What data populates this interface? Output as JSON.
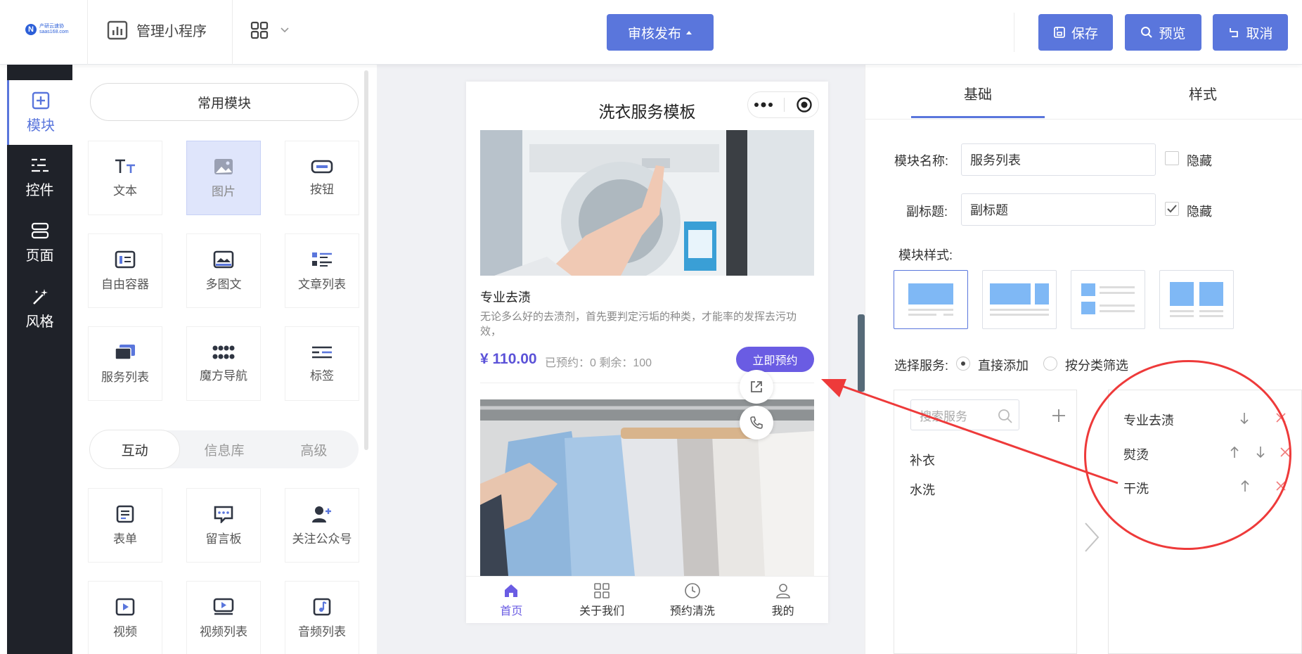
{
  "header": {
    "logo_text": "产研云速协",
    "logo_sub": "saas168.com",
    "manage_label": "管理小程序",
    "publish_label": "审核发布",
    "save_label": "保存",
    "preview_label": "预览",
    "cancel_label": "取消",
    "accent": "#5a76dc"
  },
  "leftnav": {
    "items": [
      {
        "label": "模块",
        "icon": "plus-square-icon"
      },
      {
        "label": "控件",
        "icon": "sliders-icon"
      },
      {
        "label": "页面",
        "icon": "pages-icon"
      },
      {
        "label": "风格",
        "icon": "magic-wand-icon"
      }
    ]
  },
  "modules": {
    "common_label": "常用模块",
    "tiles": [
      "文本",
      "图片",
      "按钮",
      "自由容器",
      "多图文",
      "文章列表",
      "服务列表",
      "魔方导航",
      "标签"
    ],
    "tabs": [
      "互动",
      "信息库",
      "高级"
    ],
    "interactive": [
      "表单",
      "留言板",
      "关注公众号",
      "视频",
      "视频列表",
      "音频列表"
    ]
  },
  "phone": {
    "title": "洗衣服务模板",
    "card": {
      "title": "专业去渍",
      "desc": "无论多么好的去渍剂，首先要判定污垢的种类，才能率的发挥去污功效，",
      "price": "¥ 110.00",
      "meta": "已预约：0  剩余：100",
      "button": "立即预约"
    },
    "tabbar": [
      "首页",
      "关于我们",
      "预约清洗",
      "我的"
    ]
  },
  "settings": {
    "tabs": [
      "基础",
      "样式"
    ],
    "module_name_label": "模块名称:",
    "module_name_value": "服务列表",
    "subtitle_label": "副标题:",
    "subtitle_value": "副标题",
    "hide_label": "隐藏",
    "style_label": "模块样式:",
    "select_label": "选择服务:",
    "radio_direct": "直接添加",
    "radio_filter": "按分类筛选",
    "search_placeholder": "搜索服务",
    "available": [
      "补衣",
      "水洗"
    ],
    "selected": [
      "专业去渍",
      "熨烫",
      "干洗"
    ]
  }
}
